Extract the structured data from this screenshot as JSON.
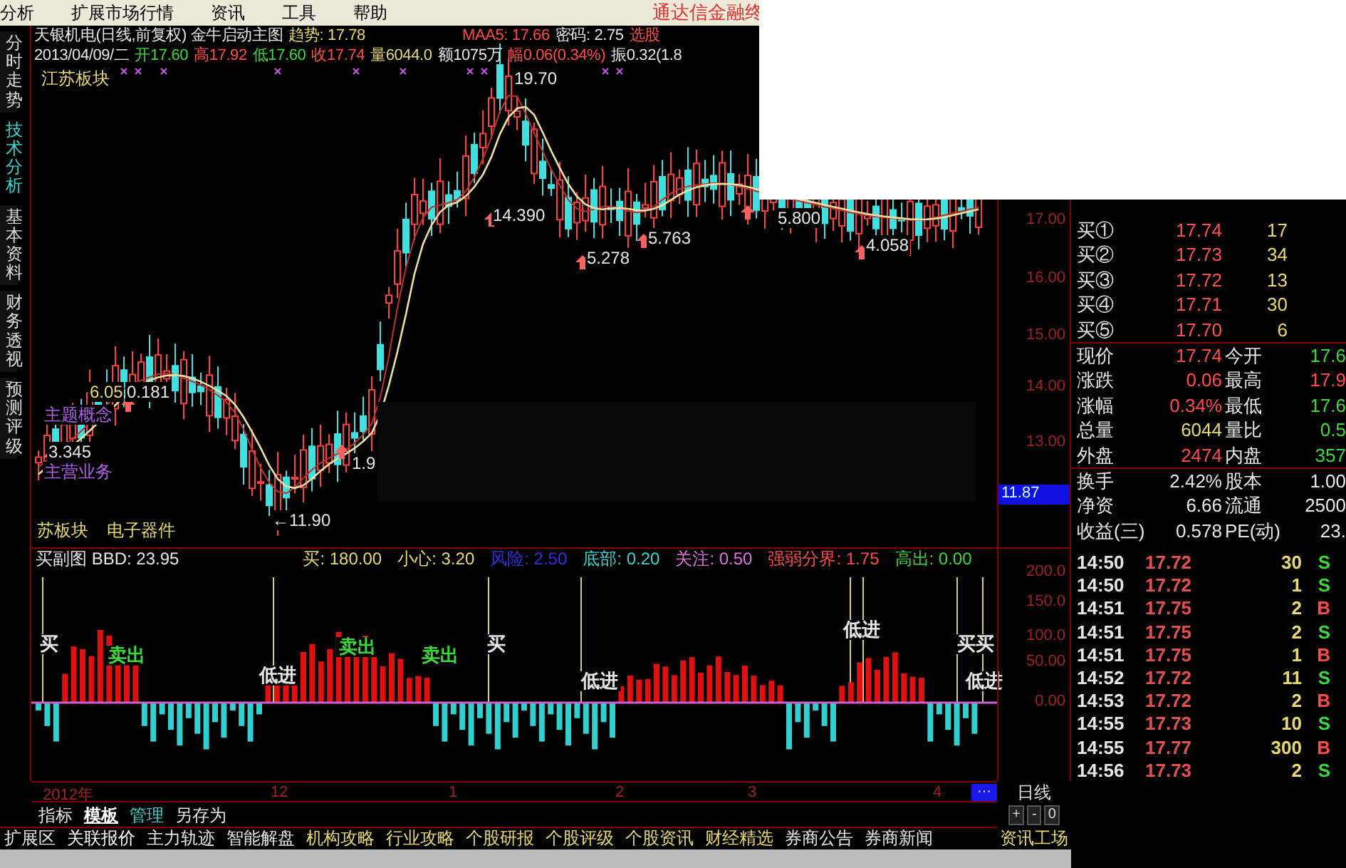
{
  "menu": [
    "分析",
    "扩展市场行情",
    "资讯",
    "工具",
    "帮助"
  ],
  "app_title": "通达信金融终",
  "side_tabs": [
    {
      "label": "分时走势",
      "selected": false
    },
    {
      "label": "技术分析",
      "selected": true
    },
    {
      "label": "基本资料",
      "selected": false
    },
    {
      "label": "财务透视",
      "selected": false
    },
    {
      "label": "预测评级",
      "selected": false
    }
  ],
  "chart": {
    "title_left": [
      {
        "text": "天银机电(日线,前复权) 金牛启动主图",
        "color": "#e6e6e6"
      },
      {
        "text": "趋势: 17.78",
        "color": "#e8d870"
      }
    ],
    "title_right": [
      {
        "text": "MAA5: 17.66",
        "color": "#ff4a4a"
      },
      {
        "text": "密码: 2.75",
        "color": "#e6e6e6"
      },
      {
        "text": "选股",
        "color": "#ff4a4a"
      }
    ],
    "info": [
      {
        "text": "2013/04/09/二",
        "color": "#e6e6e6"
      },
      {
        "text": "开17.60",
        "color": "#3ad83a"
      },
      {
        "text": "高17.92",
        "color": "#ff4a4a"
      },
      {
        "text": "低17.60",
        "color": "#3ad83a"
      },
      {
        "text": "收17.74",
        "color": "#ff4a4a"
      },
      {
        "text": "量6044.0",
        "color": "#e8d870"
      },
      {
        "text": "额1075万",
        "color": "#e6e6e6"
      },
      {
        "text": "幅0.06(0.34%)",
        "color": "#ff4a4a"
      },
      {
        "text": "振0.32(1.8",
        "color": "#e6e6e6"
      }
    ],
    "annotations": [
      {
        "text": "江苏板块",
        "color": "#e8d870"
      },
      {
        "text": "19.70",
        "color": "#e6e6e6"
      },
      {
        "text": "14.390",
        "color": "#e6e6e6"
      },
      {
        "text": "5.278",
        "color": "#e6e6e6"
      },
      {
        "text": "5.763",
        "color": "#e6e6e6"
      },
      {
        "text": "5.800",
        "color": "#e6e6e6"
      },
      {
        "text": "4.058",
        "color": "#e6e6e6"
      },
      {
        "text": "6.05",
        "color": "#e8d870"
      },
      {
        "text": "0.181",
        "color": "#e6e6e6"
      },
      {
        "text": "主题概念",
        "color": "#b060e8"
      },
      {
        "text": "3.345",
        "color": "#e6e6e6"
      },
      {
        "text": "主营业务",
        "color": "#b060e8"
      },
      {
        "text": "1.9",
        "color": "#e6e6e6"
      },
      {
        "text": "←11.90",
        "color": "#e6e6e6"
      },
      {
        "text": "苏板块",
        "color": "#e8d870"
      },
      {
        "text": "电子器件",
        "color": "#e8d870"
      }
    ],
    "price_axis": [
      "17.00",
      "16.00",
      "15.00",
      "14.00",
      "13.00"
    ],
    "current_price": "11.87"
  },
  "sub_chart": {
    "header": [
      {
        "text": "买副图 BBD: 23.95",
        "color": "#e6e6e6"
      },
      {
        "text": "买: 180.00",
        "color": "#e8d870"
      },
      {
        "text": "小心: 3.20",
        "color": "#e8d870"
      },
      {
        "text": "风险: 2.50",
        "color": "#3030e0"
      },
      {
        "text": "底部: 0.20",
        "color": "#3cd2d2"
      },
      {
        "text": "关注: 0.50",
        "color": "#e070e0"
      },
      {
        "text": "强弱分界: 1.75",
        "color": "#ff4a4a"
      },
      {
        "text": "高出: 0.00",
        "color": "#3ad83a"
      }
    ],
    "signals": [
      {
        "text": "买",
        "color": "#e6e6e6"
      },
      {
        "text": "卖出",
        "color": "#3ad83a"
      },
      {
        "text": "低进",
        "color": "#e6e6e6"
      },
      {
        "text": "卖出",
        "color": "#3ad83a"
      },
      {
        "text": "卖出",
        "color": "#3ad83a"
      },
      {
        "text": "买",
        "color": "#e6e6e6"
      },
      {
        "text": "低进",
        "color": "#e6e6e6"
      },
      {
        "text": "低进",
        "color": "#e6e6e6"
      },
      {
        "text": "买买",
        "color": "#e6e6e6"
      },
      {
        "text": "低进",
        "color": "#e6e6e6"
      }
    ],
    "axis": [
      "200.0",
      "150.0",
      "100.0",
      "50.00",
      "0.00"
    ]
  },
  "time_axis": [
    "2012年",
    "12",
    "1",
    "2",
    "3",
    "4"
  ],
  "more_button": "···",
  "period": "日线",
  "zoom_buttons": [
    "+",
    "-",
    "0"
  ],
  "quote": {
    "bids": [
      {
        "label": "买①",
        "price": "17.74",
        "volume": "17"
      },
      {
        "label": "买②",
        "price": "17.73",
        "volume": "34"
      },
      {
        "label": "买③",
        "price": "17.72",
        "volume": "13"
      },
      {
        "label": "买④",
        "price": "17.71",
        "volume": "30"
      },
      {
        "label": "买⑤",
        "price": "17.70",
        "volume": "6"
      }
    ],
    "stats": [
      {
        "left": {
          "label": "现价",
          "value": "17.74",
          "color": "#ff4a4a"
        },
        "right": {
          "label": "今开",
          "value": "17.6",
          "color": "#3ad83a"
        }
      },
      {
        "left": {
          "label": "涨跌",
          "value": "0.06",
          "color": "#ff4a4a"
        },
        "right": {
          "label": "最高",
          "value": "17.9",
          "color": "#ff4a4a"
        }
      },
      {
        "left": {
          "label": "涨幅",
          "value": "0.34%",
          "color": "#ff4a4a"
        },
        "right": {
          "label": "最低",
          "value": "17.6",
          "color": "#3ad83a"
        }
      },
      {
        "left": {
          "label": "总量",
          "value": "6044",
          "color": "#e8d870"
        },
        "right": {
          "label": "量比",
          "value": "0.5",
          "color": "#3ad83a"
        }
      },
      {
        "left": {
          "label": "外盘",
          "value": "2474",
          "color": "#ff4a4a"
        },
        "right": {
          "label": "内盘",
          "value": "357",
          "color": "#3ad83a"
        }
      }
    ],
    "extra": [
      {
        "label": "换手",
        "value": "2.42%",
        "label2": "股本",
        "value2": "1.00"
      },
      {
        "label": "净资",
        "value": "6.66",
        "label2": "流通",
        "value2": "2500"
      },
      {
        "label": "收益(三)",
        "value": "0.578",
        "label2": "PE(动)",
        "value2": "23."
      }
    ]
  },
  "ticks": [
    {
      "time": "14:50",
      "price": "17.72",
      "volume": "30",
      "side": "S",
      "color": "#3ad83a"
    },
    {
      "time": "14:50",
      "price": "17.72",
      "volume": "1",
      "side": "S",
      "color": "#3ad83a"
    },
    {
      "time": "14:51",
      "price": "17.75",
      "volume": "2",
      "side": "B",
      "color": "#ff4a4a"
    },
    {
      "time": "14:51",
      "price": "17.75",
      "volume": "2",
      "side": "S",
      "color": "#3ad83a"
    },
    {
      "time": "14:51",
      "price": "17.75",
      "volume": "1",
      "side": "B",
      "color": "#ff4a4a"
    },
    {
      "time": "14:52",
      "price": "17.72",
      "volume": "11",
      "side": "S",
      "color": "#3ad83a"
    },
    {
      "time": "14:53",
      "price": "17.72",
      "volume": "2",
      "side": "B",
      "color": "#ff4a4a"
    },
    {
      "time": "14:55",
      "price": "17.73",
      "volume": "10",
      "side": "S",
      "color": "#3ad83a"
    },
    {
      "time": "14:55",
      "price": "17.77",
      "volume": "300",
      "side": "B",
      "color": "#ff4a4a"
    },
    {
      "time": "14:56",
      "price": "17.73",
      "volume": "2",
      "side": "S",
      "color": "#3ad83a"
    }
  ],
  "bottom_tabs": [
    {
      "label": "指标",
      "selected": false,
      "color": "#e6e6e6"
    },
    {
      "label": "模板",
      "selected": true,
      "color": "#ffffff"
    },
    {
      "label": "管理",
      "selected": false,
      "color": "#3cd2d2"
    },
    {
      "label": "另存为",
      "selected": false,
      "color": "#e6e6e6"
    }
  ],
  "bottom_links": [
    {
      "label": "扩展区",
      "color": "#e6e6e6"
    },
    {
      "label": "关联报价",
      "color": "#ffffff"
    },
    {
      "label": "主力轨迹",
      "color": "#e6e6e6"
    },
    {
      "label": "智能解盘",
      "color": "#e6e6e6"
    },
    {
      "label": "机构攻略",
      "color": "#e8d870"
    },
    {
      "label": "行业攻略",
      "color": "#e8d870"
    },
    {
      "label": "个股研报",
      "color": "#e8d870"
    },
    {
      "label": "个股评级",
      "color": "#e8d870"
    },
    {
      "label": "个股资讯",
      "color": "#e8d870"
    },
    {
      "label": "财经精选",
      "color": "#e8d870"
    },
    {
      "label": "券商公告",
      "color": "#e6e6e6"
    },
    {
      "label": "券商新闻",
      "color": "#e6e6e6"
    }
  ],
  "corner_link": "资讯工场"
}
